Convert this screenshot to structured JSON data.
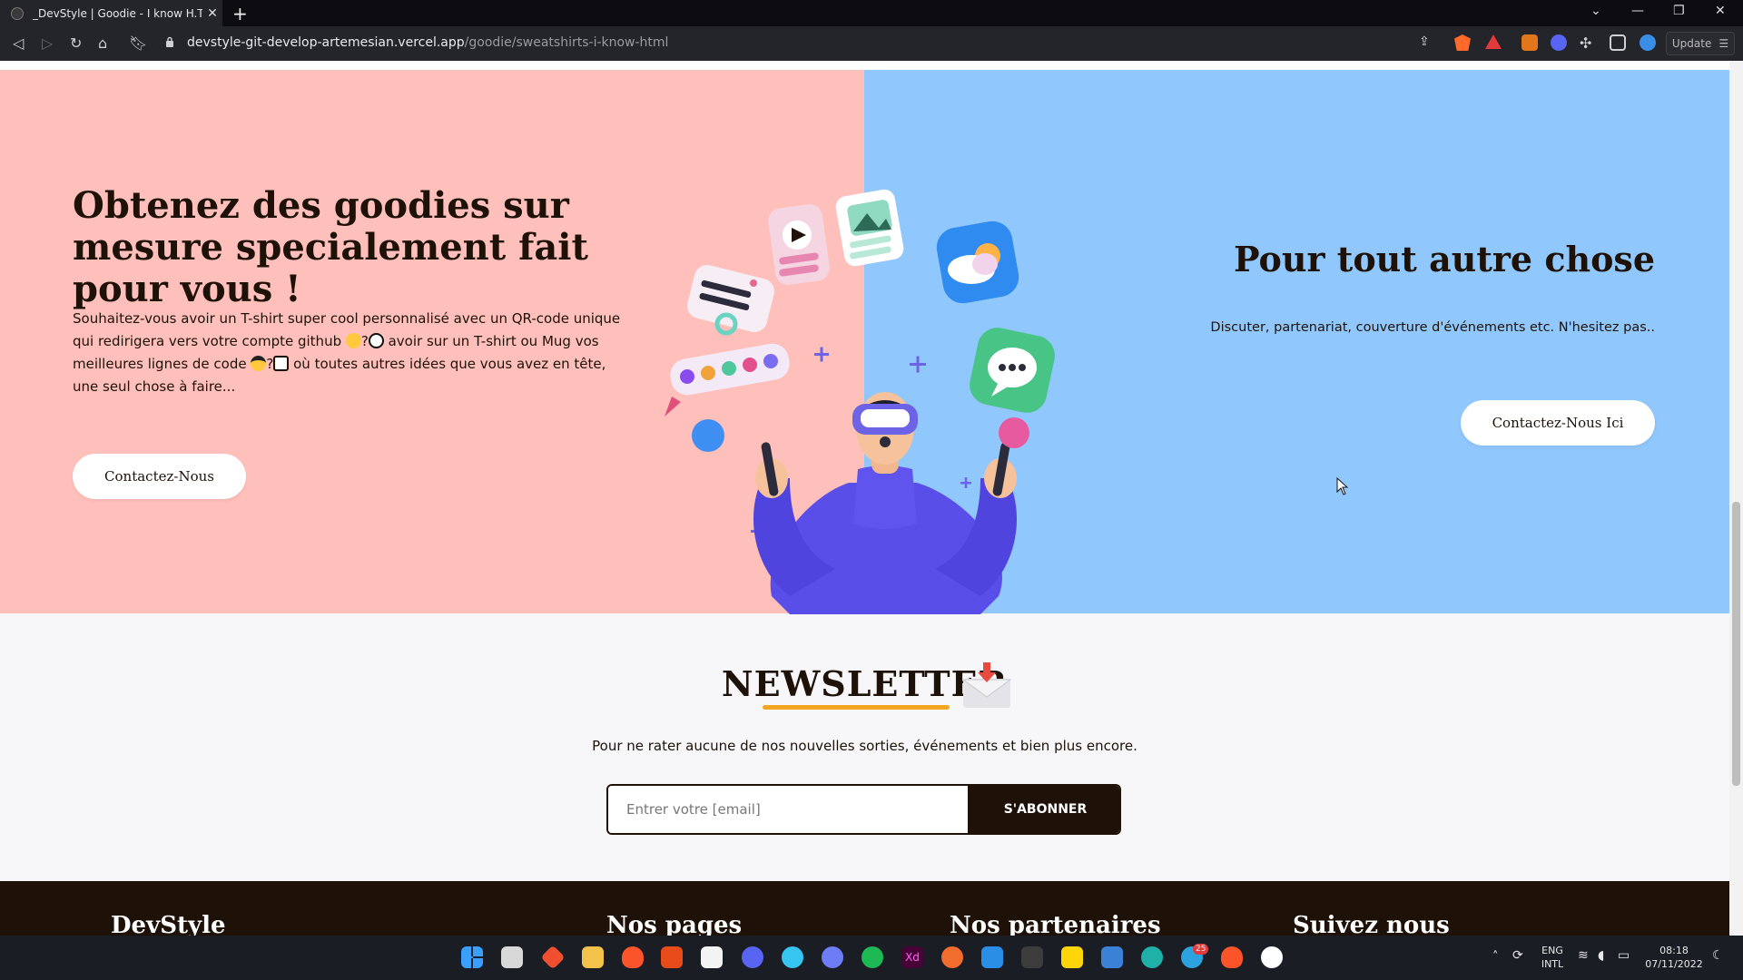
{
  "browser": {
    "tab_title": "_DevStyle | Goodie - I know H.T.M",
    "tab_close": "✕",
    "new_tab": "+",
    "url_host": "devstyle-git-develop-artemesian.vercel.app",
    "url_path": "/goodie/sweatshirts-i-know-html",
    "update_label": "Update"
  },
  "left_panel": {
    "heading": "Obtenez des goodies sur mesure specialement fait pour vous !",
    "text_1": "Souhaitez-vous avoir un T-shirt super cool personnalisé avec un QR-code unique qui redirigera vers votre compte github ",
    "text_2": "?",
    "text_3": " avoir sur un T-shirt ou Mug vos meilleures lignes de code ",
    "text_4": "?",
    "text_5": " où toutes autres idées que vous avez en tête, une seul chose à faire...",
    "button": "Contactez-Nous"
  },
  "right_panel": {
    "heading": "Pour tout autre chose",
    "text": "Discuter, partenariat, couverture d'événements etc. N'hesitez pas..",
    "button": "Contactez-Nous Ici"
  },
  "newsletter": {
    "title": "NEWSLETTER",
    "subtitle": "Pour ne rater aucune de nos nouvelles sorties, événements et bien plus encore.",
    "placeholder": "Entrer votre [email]",
    "button": "S'ABONNER"
  },
  "footer": {
    "brand": "DevStyle",
    "col_1": "Nos pages",
    "col_2": "Nos partenaires",
    "col_3": "Suivez nous"
  },
  "taskbar": {
    "lang_1": "ENG",
    "lang_2": "INTL",
    "time": "08:18",
    "date": "07/11/2022",
    "telegram_badge": "25"
  },
  "colors": {
    "pink_panel": "#ffbfbb",
    "blue_panel": "#90c7fd",
    "dark_brown": "#1e1208",
    "accent_orange": "#f5a524"
  }
}
